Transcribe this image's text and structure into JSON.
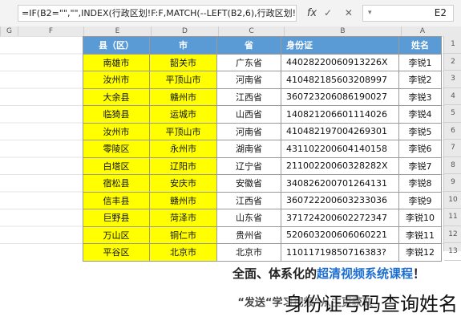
{
  "formula_bar": {
    "formula": "=IF(B2=\"\",\"\",INDEX(行政区划!F:F,MATCH(--LEFT(B2,6),行政区划!$E:$E,)))",
    "fx_label": "fx",
    "ticks": "✓ ✕ ⋮",
    "name_box": "E2",
    "name_box_arrow": "▾"
  },
  "column_headers": [
    "A",
    "B",
    "C",
    "D",
    "E",
    "F",
    "G"
  ],
  "row_headers": [
    "1",
    "2",
    "3",
    "4",
    "5",
    "6",
    "7",
    "8",
    "9",
    "10",
    "11",
    "12",
    "13"
  ],
  "table": {
    "headers": [
      "县（区）",
      "市",
      "省",
      "身份证",
      "姓名"
    ],
    "rows": [
      [
        "南雄市",
        "韶关市",
        "广东省",
        "44028220060913226X",
        "李锐1"
      ],
      [
        "汝州市",
        "平顶山市",
        "河南省",
        "410482185603208997",
        "李锐2"
      ],
      [
        "大余县",
        "赣州市",
        "江西省",
        "360723206086190027",
        "李锐3"
      ],
      [
        "临猗县",
        "运城市",
        "山西省",
        "140821206601114026",
        "李锐4"
      ],
      [
        "汝州市",
        "平顶山市",
        "河南省",
        "410482197004269301",
        "李锐5"
      ],
      [
        "零陵区",
        "永州市",
        "湖南省",
        "431102200604140158",
        "李锐6"
      ],
      [
        "白塔区",
        "辽阳市",
        "辽宁省",
        "21100220060328282X",
        "李锐7"
      ],
      [
        "宿松县",
        "安庆市",
        "安徽省",
        "340826200701264131",
        "李锐8"
      ],
      [
        "信丰县",
        "赣州市",
        "江西省",
        "360722200603233036",
        "李锐9"
      ],
      [
        "巨野县",
        "菏泽市",
        "山东省",
        "371724200602272347",
        "李锐10"
      ],
      [
        "万山区",
        "铜仁市",
        "贵州省",
        "520603200606060221",
        "李锐11"
      ],
      [
        "平谷区",
        "北京市",
        "北京市",
        "11011719850716383?",
        "李锐12"
      ]
    ]
  },
  "promo": {
    "line1_pre": "全面、体系化的",
    "line1_highlight": "超清视频系统课程",
    "line1_post": "！",
    "line2": "“发送“学习视频”从主页获取"
  },
  "caption": "身份证号码查询姓名"
}
